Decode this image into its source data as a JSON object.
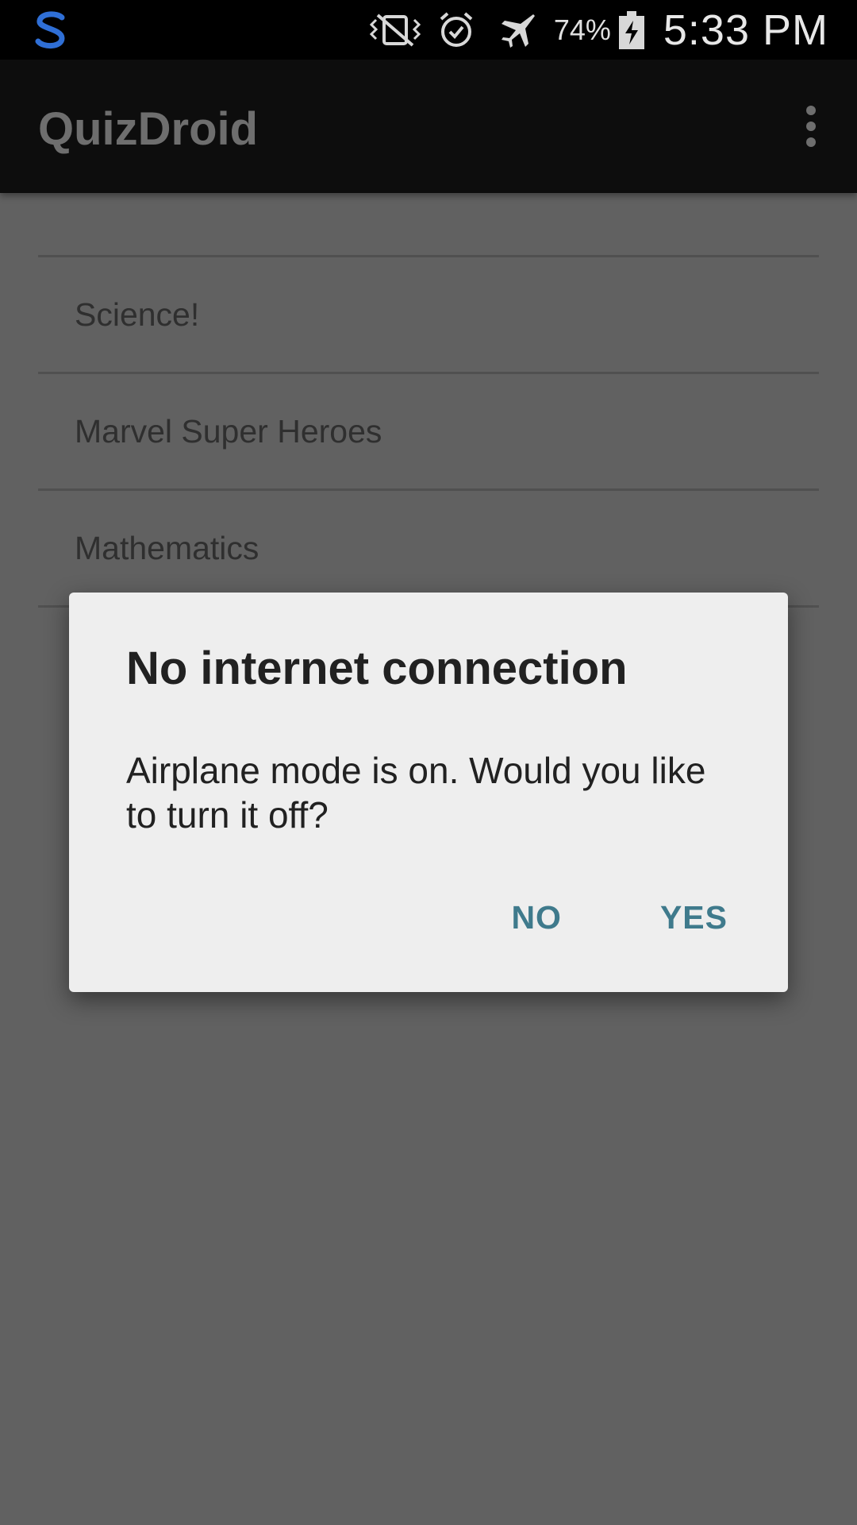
{
  "status_bar": {
    "app_icon": "swype-s-icon",
    "icons": [
      "vibrate-off-icon",
      "alarm-icon",
      "airplane-icon",
      "battery-charging-icon"
    ],
    "battery_percent": "74%",
    "time": "5:33 PM"
  },
  "app_bar": {
    "title": "QuizDroid",
    "overflow_icon": "overflow-menu-icon"
  },
  "topics": [
    {
      "label": "Science!"
    },
    {
      "label": "Marvel Super Heroes"
    },
    {
      "label": "Mathematics"
    }
  ],
  "dialog": {
    "title": "No internet connection",
    "message": "Airplane mode is on. Would you like to turn it off?",
    "no_label": "NO",
    "yes_label": "YES"
  },
  "colors": {
    "accent": "#3f7a8c",
    "dim_overlay": "#616161",
    "app_bar": "#0d0d0d"
  }
}
